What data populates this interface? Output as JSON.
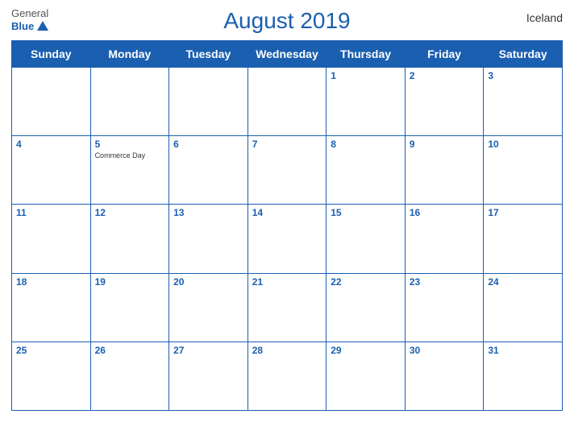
{
  "header": {
    "title": "August 2019",
    "country": "Iceland",
    "logo_general": "General",
    "logo_blue": "Blue"
  },
  "weekdays": [
    "Sunday",
    "Monday",
    "Tuesday",
    "Wednesday",
    "Thursday",
    "Friday",
    "Saturday"
  ],
  "weeks": [
    [
      {
        "day": "",
        "event": ""
      },
      {
        "day": "",
        "event": ""
      },
      {
        "day": "",
        "event": ""
      },
      {
        "day": "",
        "event": ""
      },
      {
        "day": "1",
        "event": ""
      },
      {
        "day": "2",
        "event": ""
      },
      {
        "day": "3",
        "event": ""
      }
    ],
    [
      {
        "day": "4",
        "event": ""
      },
      {
        "day": "5",
        "event": "Commerce Day"
      },
      {
        "day": "6",
        "event": ""
      },
      {
        "day": "7",
        "event": ""
      },
      {
        "day": "8",
        "event": ""
      },
      {
        "day": "9",
        "event": ""
      },
      {
        "day": "10",
        "event": ""
      }
    ],
    [
      {
        "day": "11",
        "event": ""
      },
      {
        "day": "12",
        "event": ""
      },
      {
        "day": "13",
        "event": ""
      },
      {
        "day": "14",
        "event": ""
      },
      {
        "day": "15",
        "event": ""
      },
      {
        "day": "16",
        "event": ""
      },
      {
        "day": "17",
        "event": ""
      }
    ],
    [
      {
        "day": "18",
        "event": ""
      },
      {
        "day": "19",
        "event": ""
      },
      {
        "day": "20",
        "event": ""
      },
      {
        "day": "21",
        "event": ""
      },
      {
        "day": "22",
        "event": ""
      },
      {
        "day": "23",
        "event": ""
      },
      {
        "day": "24",
        "event": ""
      }
    ],
    [
      {
        "day": "25",
        "event": ""
      },
      {
        "day": "26",
        "event": ""
      },
      {
        "day": "27",
        "event": ""
      },
      {
        "day": "28",
        "event": ""
      },
      {
        "day": "29",
        "event": ""
      },
      {
        "day": "30",
        "event": ""
      },
      {
        "day": "31",
        "event": ""
      }
    ]
  ]
}
